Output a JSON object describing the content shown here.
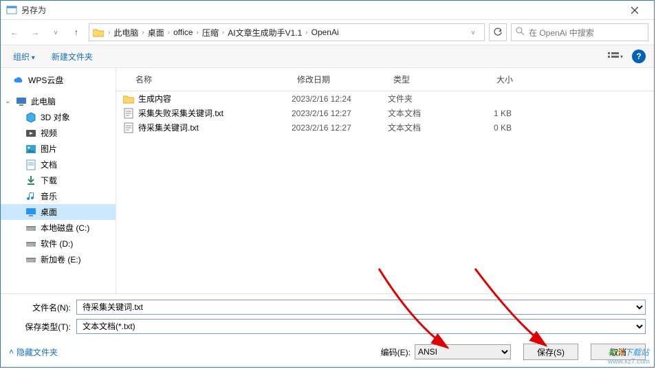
{
  "window": {
    "title": "另存为"
  },
  "nav": {
    "crumbs": [
      "此电脑",
      "桌面",
      "office",
      "压缩",
      "AI文章生成助手V1.1",
      "OpenAi"
    ],
    "search_placeholder": "在 OpenAi 中搜索"
  },
  "toolbar": {
    "organize": "组织",
    "new_folder": "新建文件夹"
  },
  "sidebar": {
    "wps": "WPS云盘",
    "thispc": "此电脑",
    "items": [
      {
        "label": "3D 对象",
        "icon": "cube"
      },
      {
        "label": "视频",
        "icon": "video"
      },
      {
        "label": "图片",
        "icon": "picture"
      },
      {
        "label": "文档",
        "icon": "doc"
      },
      {
        "label": "下载",
        "icon": "download"
      },
      {
        "label": "音乐",
        "icon": "music"
      },
      {
        "label": "桌面",
        "icon": "desktop",
        "selected": true
      },
      {
        "label": "本地磁盘 (C:)",
        "icon": "disk"
      },
      {
        "label": "软件 (D:)",
        "icon": "disk"
      },
      {
        "label": "新加卷 (E:)",
        "icon": "disk"
      }
    ]
  },
  "files": {
    "headers": {
      "name": "名称",
      "date": "修改日期",
      "type": "类型",
      "size": "大小"
    },
    "rows": [
      {
        "name": "生成内容",
        "date": "2023/2/16 12:24",
        "type": "文件夹",
        "size": "",
        "icon": "folder"
      },
      {
        "name": "采集失败采集关键词.txt",
        "date": "2023/2/16 12:27",
        "type": "文本文档",
        "size": "1 KB",
        "icon": "txt"
      },
      {
        "name": "待采集关键词.txt",
        "date": "2023/2/16 12:27",
        "type": "文本文档",
        "size": "0 KB",
        "icon": "txt"
      }
    ]
  },
  "form": {
    "filename_label": "文件名(N):",
    "filename_value": "待采集关键词.txt",
    "savetype_label": "保存类型(T):",
    "savetype_value": "文本文档(*.txt)",
    "hide_folders": "隐藏文件夹",
    "encoding_label": "编码(E):",
    "encoding_value": "ANSI",
    "save": "保存(S)",
    "cancel": "取消"
  },
  "watermark": {
    "brand": "极光下载站",
    "url": "www.xz7.com"
  }
}
